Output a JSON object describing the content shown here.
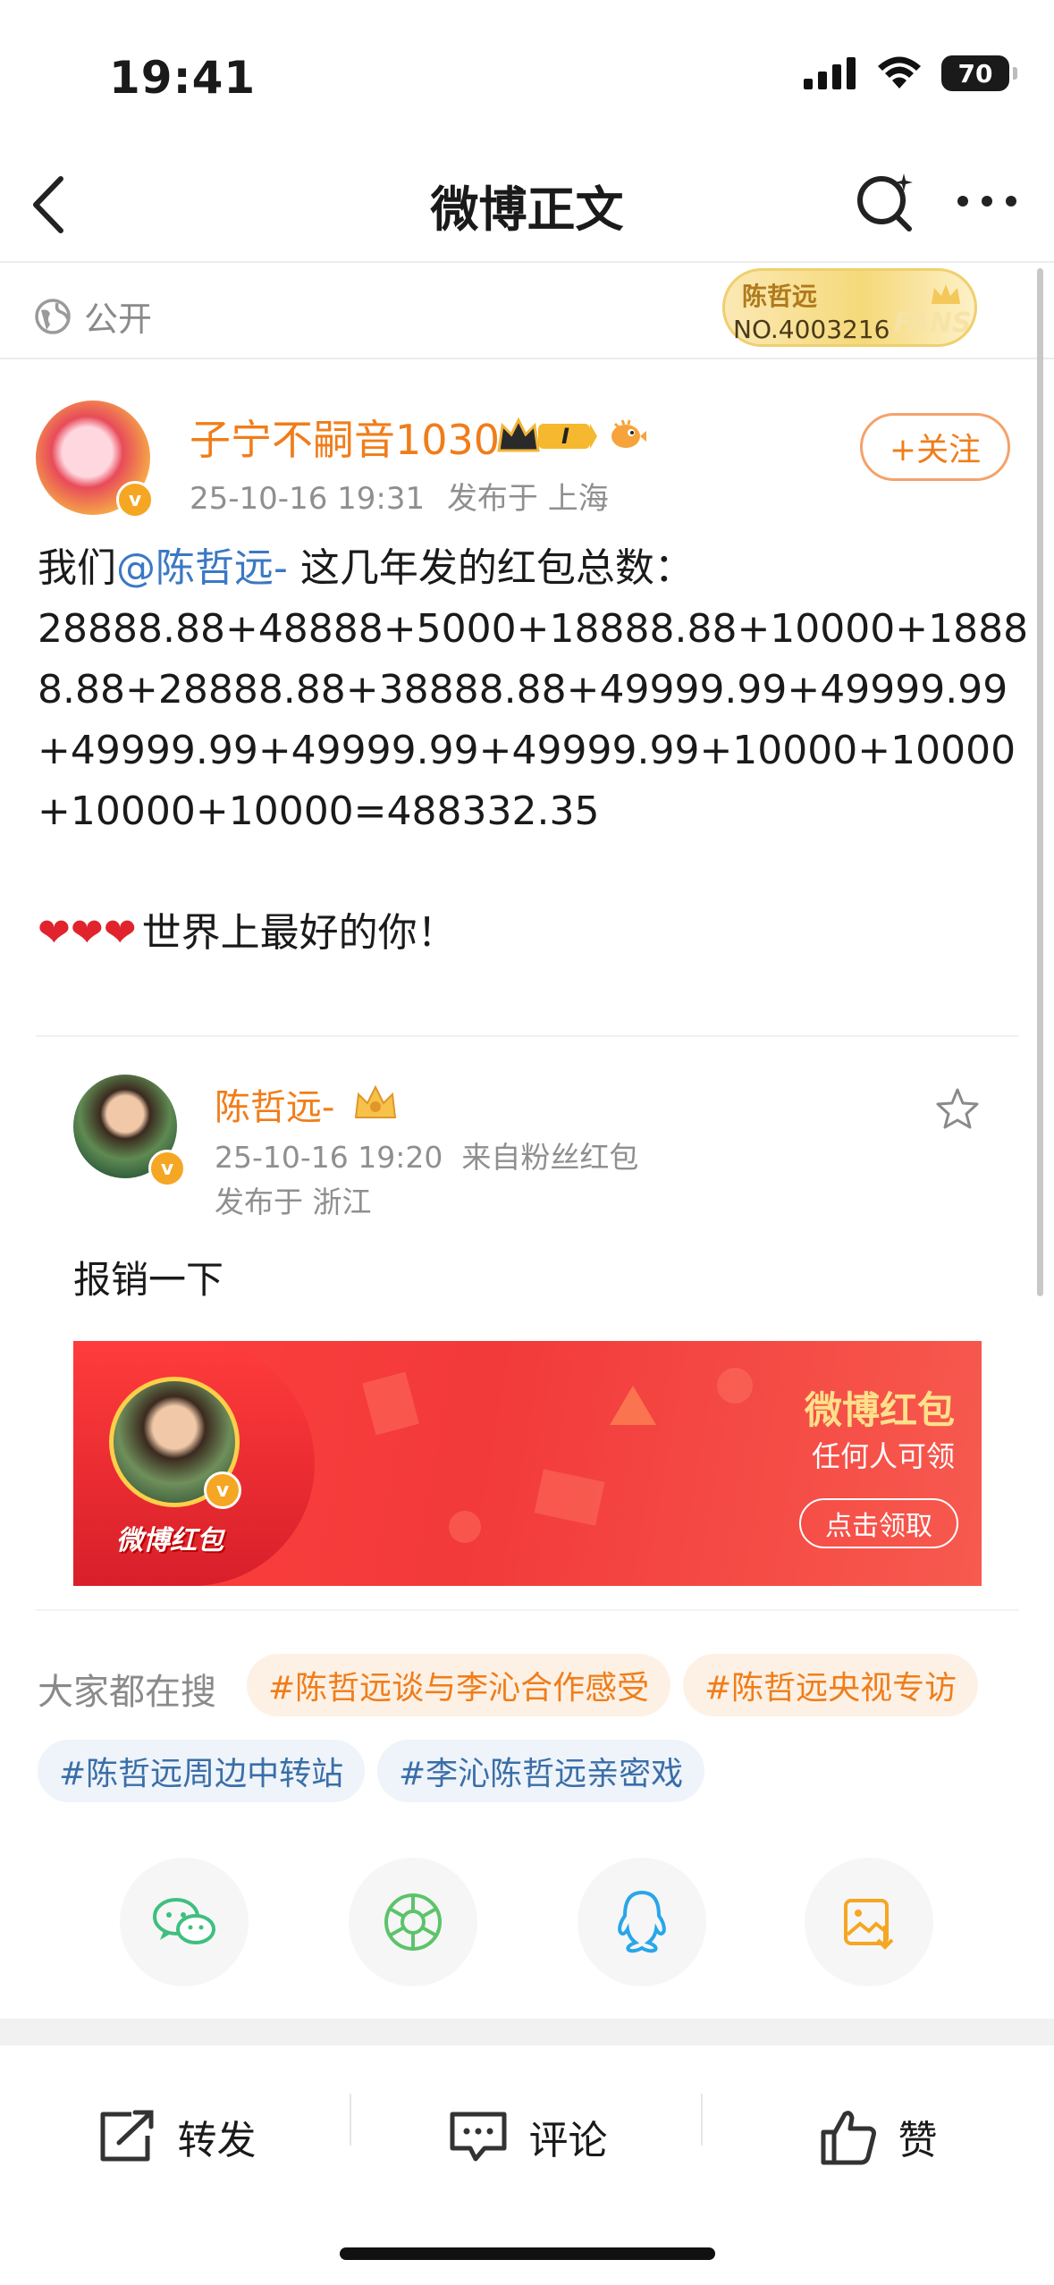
{
  "status_bar": {
    "time": "19:41",
    "battery": "70"
  },
  "nav": {
    "title": "微博正文"
  },
  "visibility": {
    "label": "公开"
  },
  "fans_badge": {
    "name": "陈哲远",
    "number": "NO.4003216",
    "word": "FANS"
  },
  "post": {
    "username": "子宁不嗣音1030",
    "level_badge": "I",
    "date": "25-10-16 19:31",
    "location": "发布于 上海",
    "follow_label": "+关注",
    "text_prefix": "我们",
    "mention": "@陈哲远-",
    "text_line1_rest": " 这几年发的红包总数：",
    "text_line2": "28888.88+48888+5000+18888.88+10000+1888",
    "text_line3": "8.88+28888.88+38888.88+49999.99+49999.99",
    "text_line4": "+49999.99+49999.99+49999.99+10000+10000",
    "text_line5": "+10000+10000=488332.35",
    "hearts": "❤❤❤",
    "closing": "世界上最好的你！"
  },
  "repost": {
    "username": "陈哲远-",
    "date": "25-10-16 19:20",
    "source": "来自粉丝红包",
    "location": "发布于 浙江",
    "text": "报销一下",
    "red_packet": {
      "logo": "微博红包",
      "title": "微博红包",
      "subtitle": "任何人可领",
      "button": "点击领取"
    }
  },
  "trending": {
    "label": "大家都在搜",
    "tags": [
      "#陈哲远谈与李沁合作感受",
      "#陈哲远央视专访",
      "#陈哲远周边中转站",
      "#李沁陈哲远亲密戏"
    ]
  },
  "share_targets": [
    "wechat-icon",
    "moments-icon",
    "qq-icon",
    "save-image-icon"
  ],
  "bottom_bar": {
    "repost": "转发",
    "comment": "评论",
    "like": "赞"
  },
  "colors": {
    "accent_orange": "#f07d1a",
    "link_blue": "#3b78c4",
    "red_packet": "#f23a3a"
  }
}
